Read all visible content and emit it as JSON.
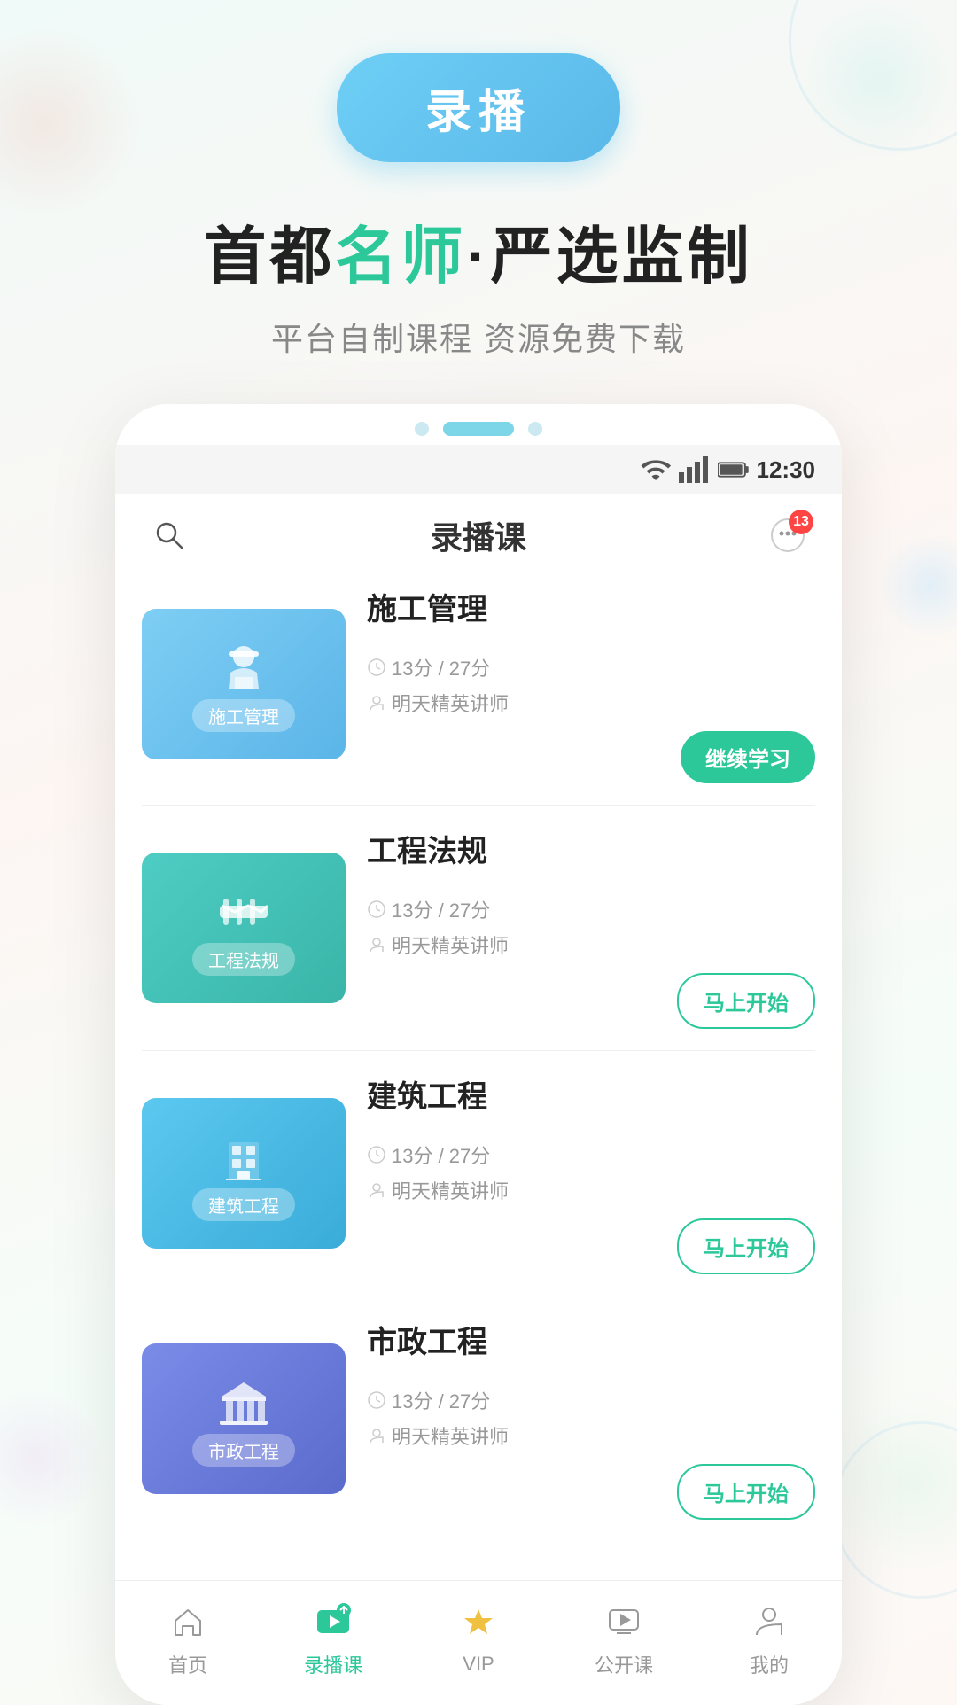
{
  "page": {
    "title": "录播课"
  },
  "header": {
    "badge_btn": "录播",
    "headline_part1": "首都",
    "headline_accent": "名师",
    "headline_part2": "·严选监制",
    "subtitle": "平台自制课程 资源免费下载"
  },
  "status_bar": {
    "time": "12:30"
  },
  "app_header": {
    "title": "录播课",
    "notification_count": "13"
  },
  "courses": [
    {
      "id": "shigong",
      "name": "施工管理",
      "thumb_label": "施工管理",
      "thumb_class": "thumb-施工管理",
      "time_info": "13分 / 27分",
      "teacher": "明天精英讲师",
      "btn_text": "继续学习",
      "btn_type": "continue"
    },
    {
      "id": "gongcheng",
      "name": "工程法规",
      "thumb_label": "工程法规",
      "thumb_class": "thumb-工程法规",
      "time_info": "13分 / 27分",
      "teacher": "明天精英讲师",
      "btn_text": "马上开始",
      "btn_type": "start"
    },
    {
      "id": "jianzhu",
      "name": "建筑工程",
      "thumb_label": "建筑工程",
      "thumb_class": "thumb-建筑工程",
      "time_info": "13分 / 27分",
      "teacher": "明天精英讲师",
      "btn_text": "马上开始",
      "btn_type": "start"
    },
    {
      "id": "shizheng",
      "name": "市政工程",
      "thumb_label": "市政工程",
      "thumb_class": "thumb-市政工程",
      "time_info": "13分 / 27分",
      "teacher": "明天精英讲师",
      "btn_text": "马上开始",
      "btn_type": "start"
    }
  ],
  "bottom_nav": [
    {
      "id": "home",
      "label": "首页",
      "active": false
    },
    {
      "id": "luboke",
      "label": "录播课",
      "active": true
    },
    {
      "id": "vip",
      "label": "VIP",
      "active": false
    },
    {
      "id": "gonkaike",
      "label": "公开课",
      "active": false
    },
    {
      "id": "mine",
      "label": "我的",
      "active": false
    }
  ],
  "thumb_icons": {
    "shigong": "👷",
    "gongcheng": "🚧",
    "jianzhu": "🏢",
    "shizheng": "🏛️"
  }
}
